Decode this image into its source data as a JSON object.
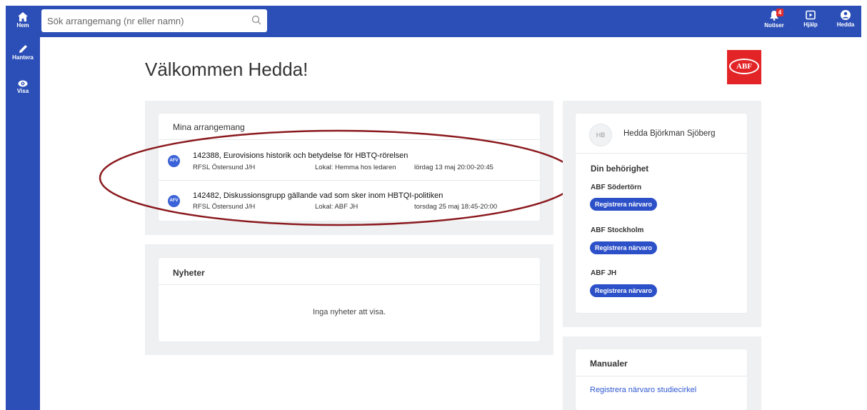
{
  "sidebar": {
    "items": [
      {
        "label": "Hem",
        "icon": "home-icon"
      },
      {
        "label": "Hantera",
        "icon": "pencil-icon"
      },
      {
        "label": "Visa",
        "icon": "eye-icon"
      }
    ]
  },
  "topbar": {
    "search_placeholder": "Sök arrangemang (nr eller namn)",
    "notifications": {
      "label": "Notiser",
      "count": "4"
    },
    "help_label": "Hjälp",
    "user_label": "Hedda"
  },
  "welcome": "Välkommen Hedda!",
  "logo_text": "ABF",
  "events": {
    "title": "Mina arrangemang",
    "items": [
      {
        "avatar": "AFV",
        "title": "142388, Eurovisions historik och betydelse för HBTQ-rörelsen",
        "org": "RFSL Östersund J/H",
        "location": "Lokal: Hemma hos ledaren",
        "time": "lördag 13 maj 20:00-20:45"
      },
      {
        "avatar": "AFV",
        "title": "142482, Diskussionsgrupp gällande vad som sker inom HBTQI-politiken",
        "org": "RFSL Östersund J/H",
        "location": "Lokal: ABF JH",
        "time": "torsdag 25 maj 18:45-20:00"
      }
    ]
  },
  "news": {
    "title": "Nyheter",
    "empty": "Inga nyheter att visa."
  },
  "profile": {
    "initials": "HB",
    "name": "Hedda Björkman Sjöberg",
    "permissions_title": "Din behörighet",
    "orgs": [
      {
        "name": "ABF Södertörn",
        "button": "Registrera närvaro"
      },
      {
        "name": "ABF Stockholm",
        "button": "Registrera närvaro"
      },
      {
        "name": "ABF JH",
        "button": "Registrera närvaro"
      }
    ]
  },
  "manuals": {
    "title": "Manualer",
    "link": "Registrera närvaro studiecirkel"
  },
  "colors": {
    "primary": "#2c4fb7",
    "accent_red": "#e32427",
    "annotation": "#8b1a1f"
  }
}
